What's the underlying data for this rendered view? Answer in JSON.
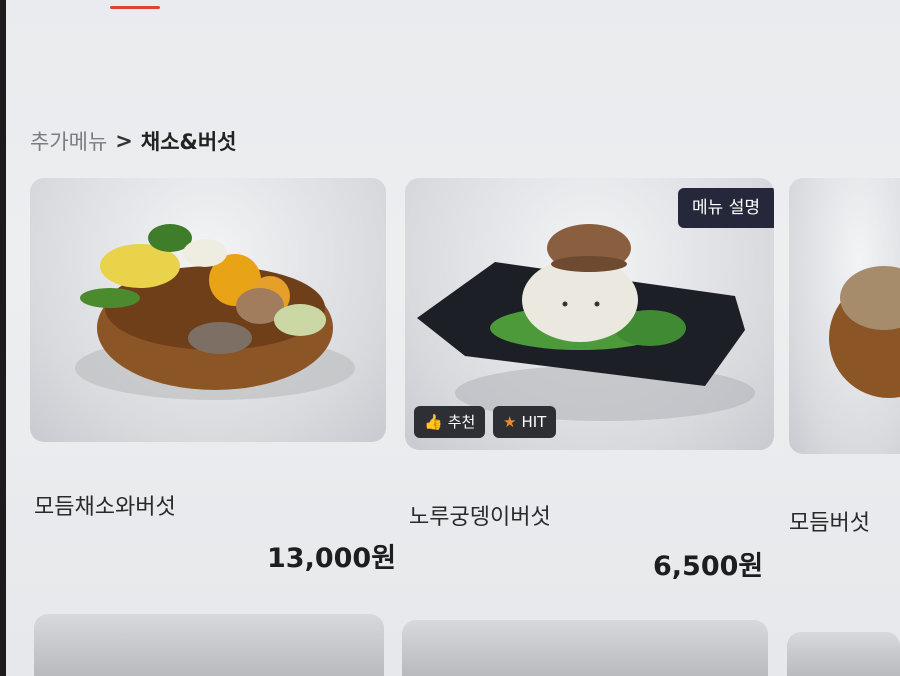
{
  "breadcrumb": {
    "parent": "추가메뉴",
    "separator": ">",
    "current": "채소&버섯"
  },
  "menu_items": [
    {
      "name": "모듬채소와버섯",
      "price": "13,000원"
    },
    {
      "name": "노루궁뎅이버섯",
      "price": "6,500원",
      "description_button": "메뉴 설명",
      "badges": [
        {
          "label": "추천",
          "icon": "thumbs-up-icon"
        },
        {
          "label": "HIT",
          "icon": "star-icon"
        }
      ]
    },
    {
      "name": "모듬버섯"
    }
  ]
}
